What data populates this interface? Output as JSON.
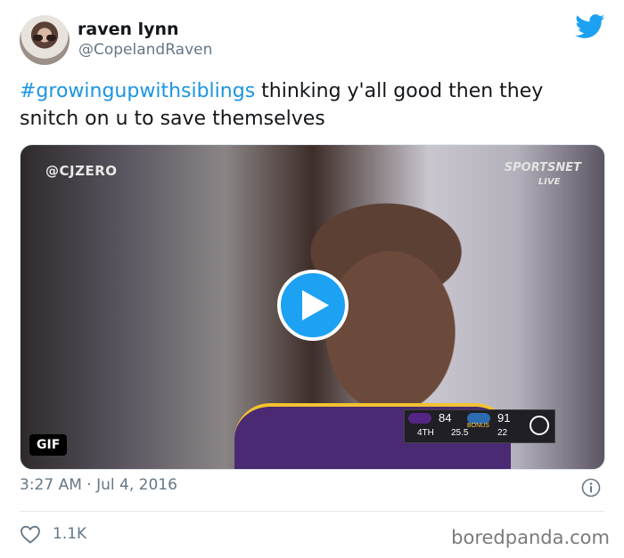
{
  "user": {
    "name": "raven lynn",
    "handle": "@CopelandRaven"
  },
  "tweet": {
    "hashtag": "#growingupwithsiblings",
    "text": " thinking y'all good then they snitch on u to save themselves"
  },
  "media": {
    "watermark_left": "@CJZERO",
    "watermark_right": "SPORTSNET",
    "watermark_right_sub": "LIVE",
    "badge": "GIF",
    "scorebug": {
      "team1_score": "84",
      "team2_score": "91",
      "quarter": "4TH",
      "clock": "25.5",
      "shot_clock": "22",
      "bonus": "BONUS"
    }
  },
  "meta": {
    "timestamp": "3:27 AM · Jul 4, 2016"
  },
  "actions": {
    "like_count": "1.1K"
  },
  "credit": "boredpanda.com",
  "colors": {
    "link": "#1b95e0",
    "twitter_blue": "#1da1f2",
    "secondary_text": "#657786"
  }
}
